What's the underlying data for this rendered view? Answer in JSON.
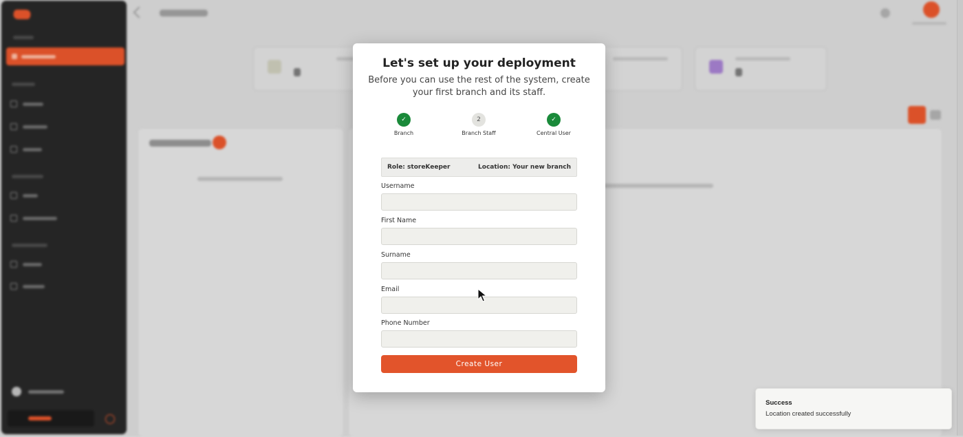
{
  "modal": {
    "title": "Let's set up your deployment",
    "subtitle": "Before you can use the rest of the system, create your first branch and its staff.",
    "steps": [
      {
        "label": "Branch",
        "marker": "✓",
        "state": "done"
      },
      {
        "label": "Branch Staff",
        "marker": "2",
        "state": "current"
      },
      {
        "label": "Central User",
        "marker": "✓",
        "state": "done"
      }
    ],
    "role_text": "Role: storeKeeper",
    "location_text": "Location: Your new branch",
    "fields": {
      "username": {
        "label": "Username",
        "value": ""
      },
      "first_name": {
        "label": "First Name",
        "value": ""
      },
      "surname": {
        "label": "Surname",
        "value": ""
      },
      "email": {
        "label": "Email",
        "value": ""
      },
      "phone": {
        "label": "Phone Number",
        "value": ""
      }
    },
    "submit_label": "Create User"
  },
  "toast": {
    "title": "Success",
    "message": "Location created successfully"
  },
  "colors": {
    "accent": "#e2542b",
    "step_done": "#1a8a3a",
    "sidebar": "#262626"
  }
}
